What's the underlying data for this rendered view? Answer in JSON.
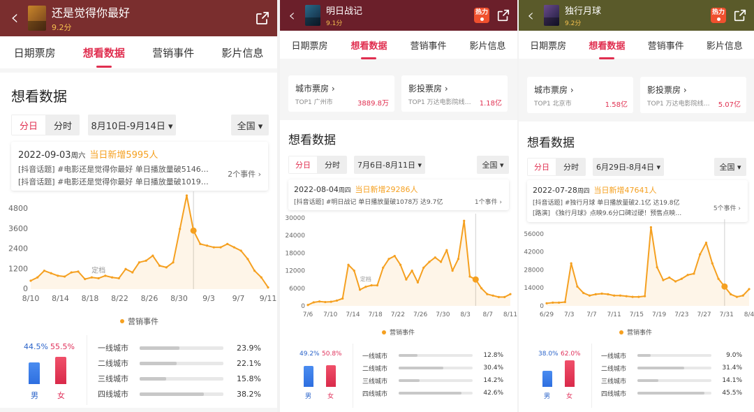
{
  "panels": [
    {
      "id": "p1",
      "header_bg": "#7a2e2e",
      "title": "还是觉得你最好",
      "score": "9.2分",
      "tabs": [
        "日期票房",
        "想看数据",
        "营销事件",
        "影片信息"
      ],
      "active_tab": 1,
      "section_title": "想看数据",
      "seg": [
        "分日",
        "分时"
      ],
      "date_range": "8月10日-9月14日 ▾",
      "region": "全国 ▾",
      "event": {
        "date": "2022-09-03",
        "weekday": "周六",
        "added": "当日新增5995人",
        "lines": [
          "[抖音话题] #电影还是觉得你最好 单日播放量破5146…",
          "[抖音话题] #电影还是觉得你最好 单日播放量破1019…"
        ],
        "count": "2个事件 ›"
      },
      "legend": "营销事件",
      "gender": {
        "male_pct": "44.5%",
        "female_pct": "55.5%",
        "male": 44.5,
        "female": 55.5,
        "male_label": "男",
        "female_label": "女"
      },
      "tiers": [
        {
          "name": "一线城市",
          "value": "23.9%",
          "pct": 23.9
        },
        {
          "name": "二线城市",
          "value": "22.1%",
          "pct": 22.1
        },
        {
          "name": "三线城市",
          "value": "15.8%",
          "pct": 15.8
        },
        {
          "name": "四线城市",
          "value": "38.2%",
          "pct": 38.2
        }
      ]
    },
    {
      "id": "p2",
      "header_bg": "#6b1f2a",
      "title": "明日战记",
      "score": "9.1分",
      "hot": "热力",
      "tabs": [
        "日期票房",
        "想看数据",
        "营销事件",
        "影片信息"
      ],
      "active_tab": 1,
      "city_cards": [
        {
          "title": "城市票房 ›",
          "sub": "TOP1 广州市",
          "value": "3889.8万"
        },
        {
          "title": "影投票房 ›",
          "sub": "TOP1 万达电影院线…",
          "value": "1.18亿"
        }
      ],
      "section_title": "想看数据",
      "seg": [
        "分日",
        "分时"
      ],
      "date_range": "7月6日-8月11日 ▾",
      "region": "全国 ▾",
      "event": {
        "date": "2022-08-04",
        "weekday": "周四",
        "added": "当日新增29286人",
        "lines": [
          "[抖音话题] #明日战记 单日播放量破1078万 达9.7亿"
        ],
        "count": "1个事件 ›"
      },
      "legend": "营销事件",
      "gender": {
        "male_pct": "49.2%",
        "female_pct": "50.8%",
        "male": 49.2,
        "female": 50.8,
        "male_label": "男",
        "female_label": "女"
      },
      "tiers": [
        {
          "name": "一线城市",
          "value": "12.8%",
          "pct": 12.8
        },
        {
          "name": "二线城市",
          "value": "30.4%",
          "pct": 30.4
        },
        {
          "name": "三线城市",
          "value": "14.2%",
          "pct": 14.2
        },
        {
          "name": "四线城市",
          "value": "42.6%",
          "pct": 42.6
        }
      ]
    },
    {
      "id": "p3",
      "header_bg": "#5a5a2a",
      "title": "独行月球",
      "score": "9.2分",
      "hot": "热力",
      "tabs": [
        "日期票房",
        "想看数据",
        "营销事件",
        "影片信息"
      ],
      "active_tab": 1,
      "city_cards": [
        {
          "title": "城市票房 ›",
          "sub": "TOP1 北京市",
          "value": "1.58亿"
        },
        {
          "title": "影投票房 ›",
          "sub": "TOP1 万达电影院线…",
          "value": "5.07亿"
        }
      ],
      "section_title": "想看数据",
      "seg": [
        "分日",
        "分时"
      ],
      "date_range": "6月29日-8月4日 ▾",
      "region": "全国 ▾",
      "event": {
        "date": "2022-07-28",
        "weekday": "周四",
        "added": "当日新增47641人",
        "lines": [
          "[抖音话题] #独行月球 单日播放量破2.1亿 达19.8亿",
          "[路演] 《独行月球》点映9.6分口碑过硬！预售点映…"
        ],
        "count": "5个事件 ›"
      },
      "legend": "营销事件",
      "gender": {
        "male_pct": "38.0%",
        "female_pct": "62.0%",
        "male": 38.0,
        "female": 62.0,
        "male_label": "男",
        "female_label": "女"
      },
      "tiers": [
        {
          "name": "一线城市",
          "value": "9.0%",
          "pct": 9.0
        },
        {
          "name": "二线城市",
          "value": "31.4%",
          "pct": 31.4
        },
        {
          "name": "三线城市",
          "value": "14.1%",
          "pct": 14.1
        },
        {
          "name": "四线城市",
          "value": "45.5%",
          "pct": 45.5
        }
      ]
    }
  ],
  "chart_data": [
    {
      "type": "line",
      "title": "",
      "x_ticks": [
        "8/10",
        "8/14",
        "8/18",
        "8/22",
        "8/26",
        "8/30",
        "9/3",
        "9/7",
        "9/11"
      ],
      "y_ticks": [
        0,
        1200,
        2400,
        3600,
        4800
      ],
      "ylim": [
        0,
        5600
      ],
      "annotation": "定档",
      "highlight_index": 24,
      "values": [
        500,
        700,
        1100,
        950,
        800,
        750,
        1000,
        1050,
        600,
        700,
        650,
        800,
        700,
        650,
        1200,
        1000,
        1600,
        1700,
        2000,
        1400,
        1300,
        1600,
        3600,
        5600,
        3500,
        2700,
        2600,
        2500,
        2500,
        2700,
        2500,
        2300,
        1800,
        1100,
        700,
        100
      ]
    },
    {
      "type": "line",
      "title": "",
      "x_ticks": [
        "7/6",
        "7/10",
        "7/14",
        "7/18",
        "7/22",
        "7/26",
        "7/30",
        "8/3",
        "8/7",
        "8/11"
      ],
      "y_ticks": [
        0,
        6000,
        12000,
        18000,
        24000,
        30000
      ],
      "ylim": [
        0,
        30000
      ],
      "annotation": "定档",
      "highlight_index": 29,
      "values": [
        300,
        1200,
        1500,
        1300,
        1400,
        1800,
        2500,
        14000,
        12000,
        5500,
        6500,
        7000,
        7000,
        13000,
        16000,
        17000,
        14000,
        9000,
        12000,
        8000,
        13000,
        15000,
        16500,
        15000,
        19000,
        12000,
        16000,
        29000,
        10000,
        9000,
        6000,
        4000,
        3500,
        3000,
        3000,
        4000
      ]
    },
    {
      "type": "line",
      "title": "",
      "x_ticks": [
        "6/29",
        "7/3",
        "7/7",
        "7/11",
        "7/15",
        "7/19",
        "7/23",
        "7/27",
        "7/31",
        "8/4"
      ],
      "y_ticks": [
        0,
        14000,
        28000,
        42000,
        56000
      ],
      "ylim": [
        0,
        64000
      ],
      "annotation": "",
      "highlight_index": 29,
      "values": [
        2000,
        2500,
        2500,
        3000,
        33000,
        15000,
        10000,
        8000,
        9000,
        9500,
        9000,
        8000,
        8000,
        7500,
        7000,
        7000,
        7500,
        61000,
        30000,
        20000,
        22000,
        19000,
        21000,
        24000,
        25000,
        40000,
        49000,
        33000,
        21000,
        15000,
        9000,
        7000,
        8000,
        13000
      ]
    }
  ]
}
